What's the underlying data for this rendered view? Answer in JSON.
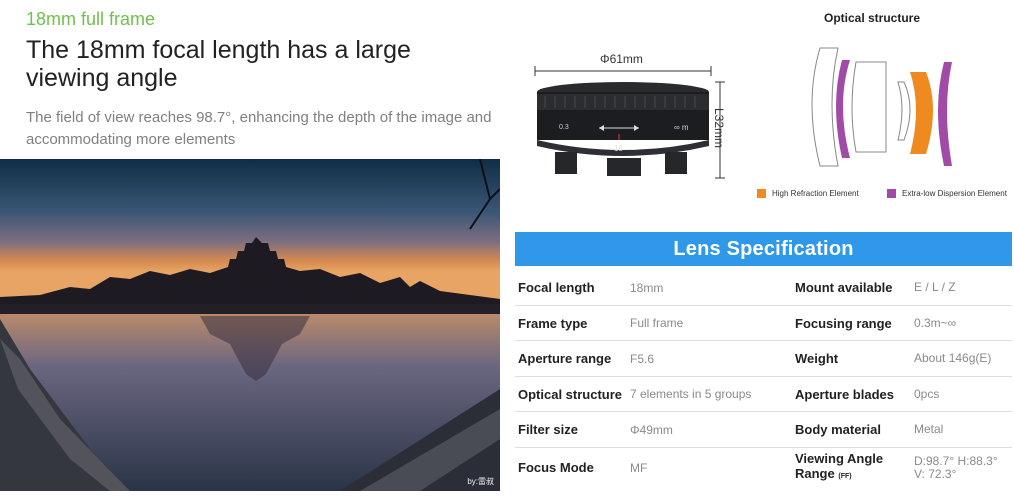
{
  "hero": {
    "kicker": "18mm full frame",
    "headline": "The 18mm focal length has a large viewing angle",
    "description": "The field of view reaches 98.7°, enhancing the depth of the image and accommodating more elements",
    "photo_credit": "by:雷叔"
  },
  "lens": {
    "diameter_label": "Φ61mm",
    "length_label": "L32mm",
    "focus_scale_left": "0.3",
    "focus_scale_right": "∞ m",
    "focal_marking": "18"
  },
  "optical": {
    "title": "Optical structure",
    "legend": [
      {
        "label": "High Refraction Element",
        "color": "#ee8a1f"
      },
      {
        "label": "Extra-low Dispersion Element",
        "color": "#a24aa8"
      }
    ]
  },
  "spec": {
    "title": "Lens Specification",
    "rows": [
      {
        "k1": "Focal length",
        "v1": "18mm",
        "k2": "Mount available",
        "v2": "E / L / Z"
      },
      {
        "k1": "Frame type",
        "v1": "Full frame",
        "k2": "Focusing range",
        "v2": "0.3m~∞"
      },
      {
        "k1": "Aperture range",
        "v1": "F5.6",
        "k2": "Weight",
        "v2": "About 146g(E)"
      },
      {
        "k1": "Optical structure",
        "v1": "7 elements in 5 groups",
        "k2": "Aperture blades",
        "v2": "0pcs"
      },
      {
        "k1": "Filter size",
        "v1": "Φ49mm",
        "k2": "Body material",
        "v2": "Metal"
      }
    ],
    "last_row": {
      "k1": "Focus Mode",
      "v1": "MF",
      "k2a": "Viewing Angle",
      "k2b": "Range",
      "k2c": "(FF)",
      "v2a": "D:98.7° H:88.3°",
      "v2b": "V: 72.3°"
    }
  }
}
